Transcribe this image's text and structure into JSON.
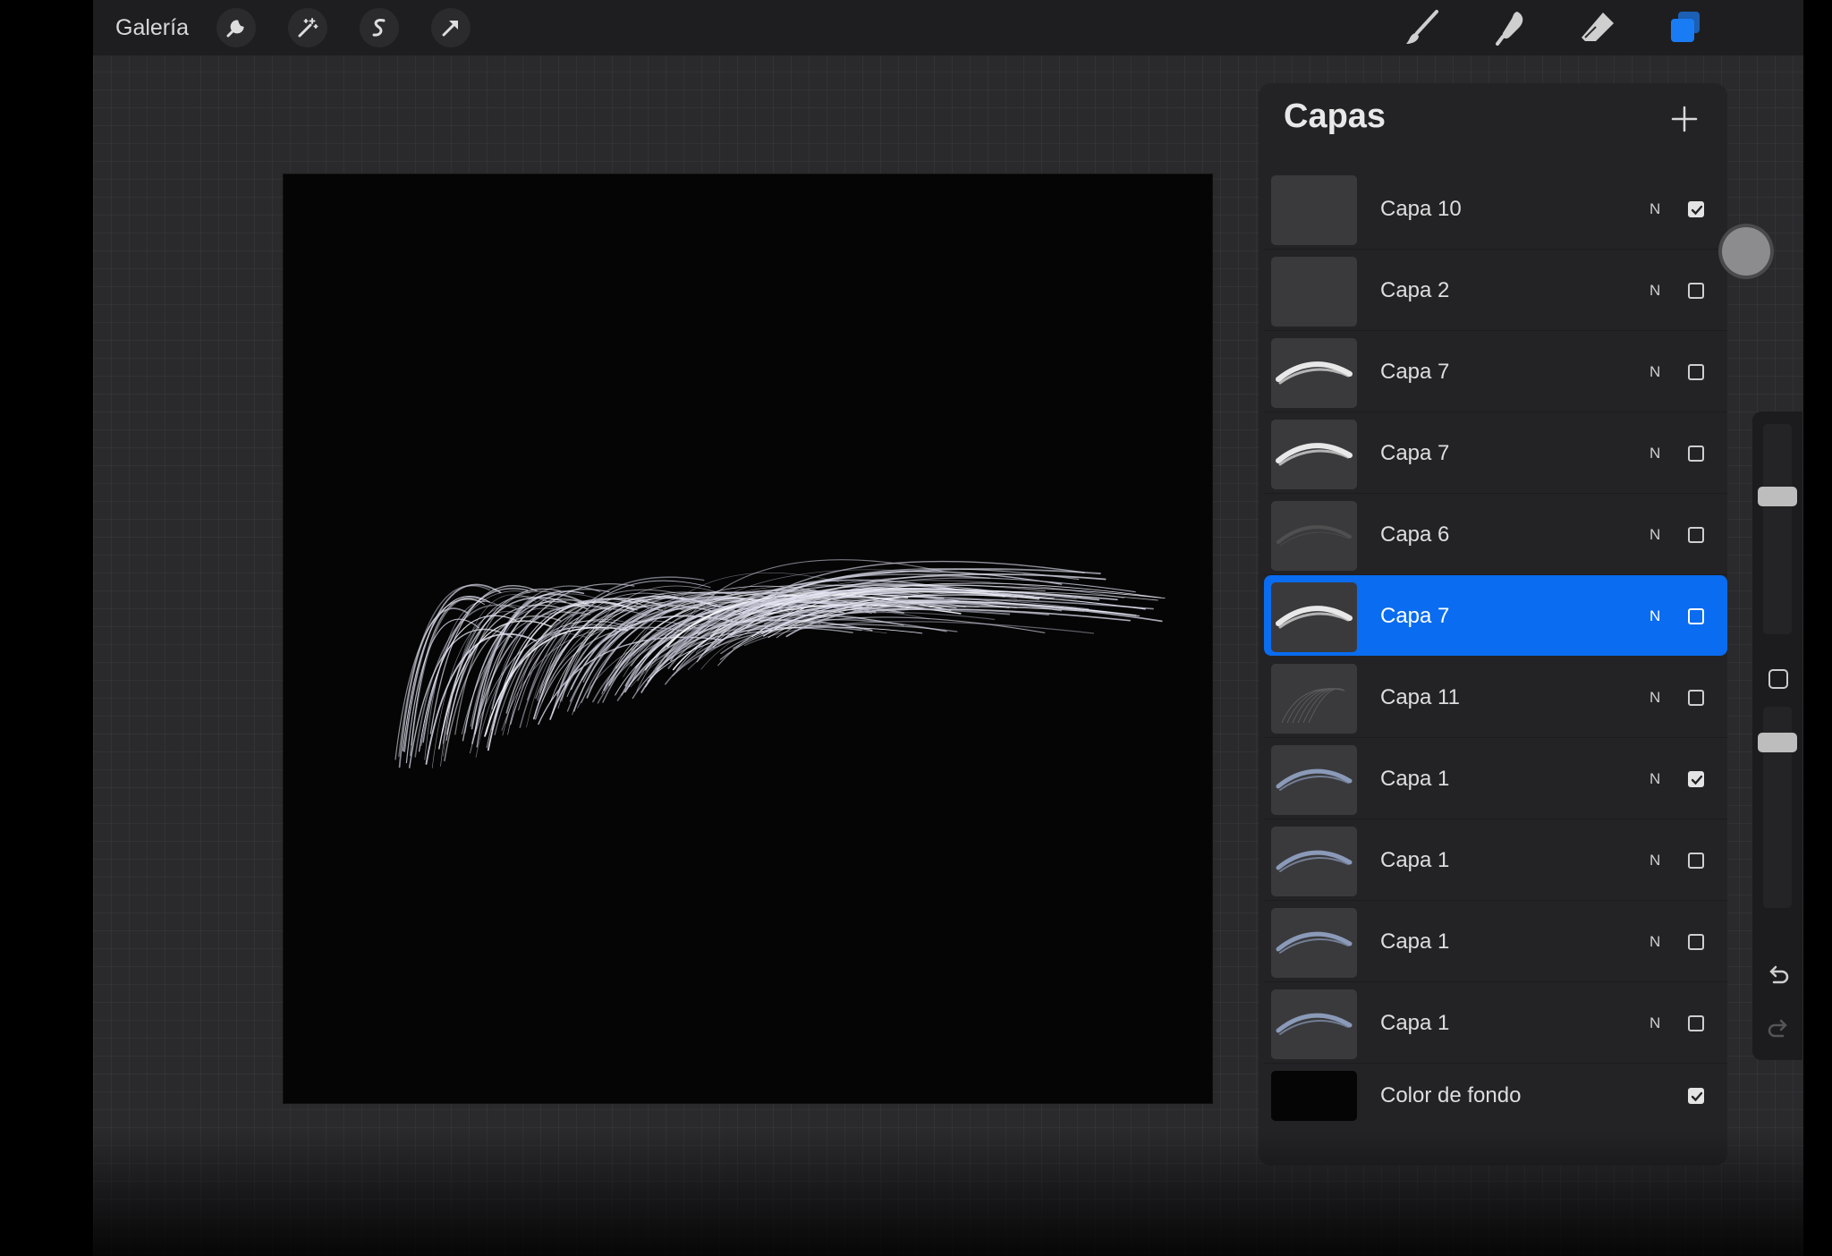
{
  "topbar": {
    "gallery_label": "Galería",
    "left_tools": [
      {
        "name": "wrench-icon"
      },
      {
        "name": "magic-wand-icon"
      },
      {
        "name": "selection-s-icon"
      },
      {
        "name": "transform-arrow-icon"
      }
    ],
    "right_tools": [
      {
        "name": "brush-icon"
      },
      {
        "name": "smudge-icon"
      },
      {
        "name": "eraser-icon"
      },
      {
        "name": "layers-icon",
        "active_color": "#1a7cf5"
      },
      {
        "name": "color-circle-icon",
        "color": "#5a6cf0"
      }
    ]
  },
  "layers_panel": {
    "title": "Capas",
    "add_icon": "plus-icon",
    "rows": [
      {
        "name": "Capa 10",
        "blend": "N",
        "visible": true,
        "selected": false,
        "thumb": "empty"
      },
      {
        "name": "Capa 2",
        "blend": "N",
        "visible": false,
        "selected": false,
        "thumb": "empty"
      },
      {
        "name": "Capa 7",
        "blend": "N",
        "visible": false,
        "selected": false,
        "thumb": "brow-white"
      },
      {
        "name": "Capa 7",
        "blend": "N",
        "visible": false,
        "selected": false,
        "thumb": "brow-white"
      },
      {
        "name": "Capa 6",
        "blend": "N",
        "visible": false,
        "selected": false,
        "thumb": "faint"
      },
      {
        "name": "Capa 7",
        "blend": "N",
        "visible": false,
        "selected": true,
        "thumb": "brow-white"
      },
      {
        "name": "Capa 11",
        "blend": "N",
        "visible": false,
        "selected": false,
        "thumb": "lines"
      },
      {
        "name": "Capa 1",
        "blend": "N",
        "visible": true,
        "selected": false,
        "thumb": "brow-blue"
      },
      {
        "name": "Capa 1",
        "blend": "N",
        "visible": false,
        "selected": false,
        "thumb": "brow-blue"
      },
      {
        "name": "Capa 1",
        "blend": "N",
        "visible": false,
        "selected": false,
        "thumb": "brow-blue"
      },
      {
        "name": "Capa 1",
        "blend": "N",
        "visible": false,
        "selected": false,
        "thumb": "brow-blue"
      }
    ],
    "background_row": {
      "name": "Color de fondo",
      "visible": true,
      "color": "#050506"
    }
  },
  "sidebar": {
    "size_slider_value": 0.2,
    "opacity_slider_value": 0.12,
    "modify_icon": "square-icon",
    "undo_icon": "undo-icon",
    "redo_icon": "redo-icon"
  },
  "accent_color": "#0a6cf0"
}
